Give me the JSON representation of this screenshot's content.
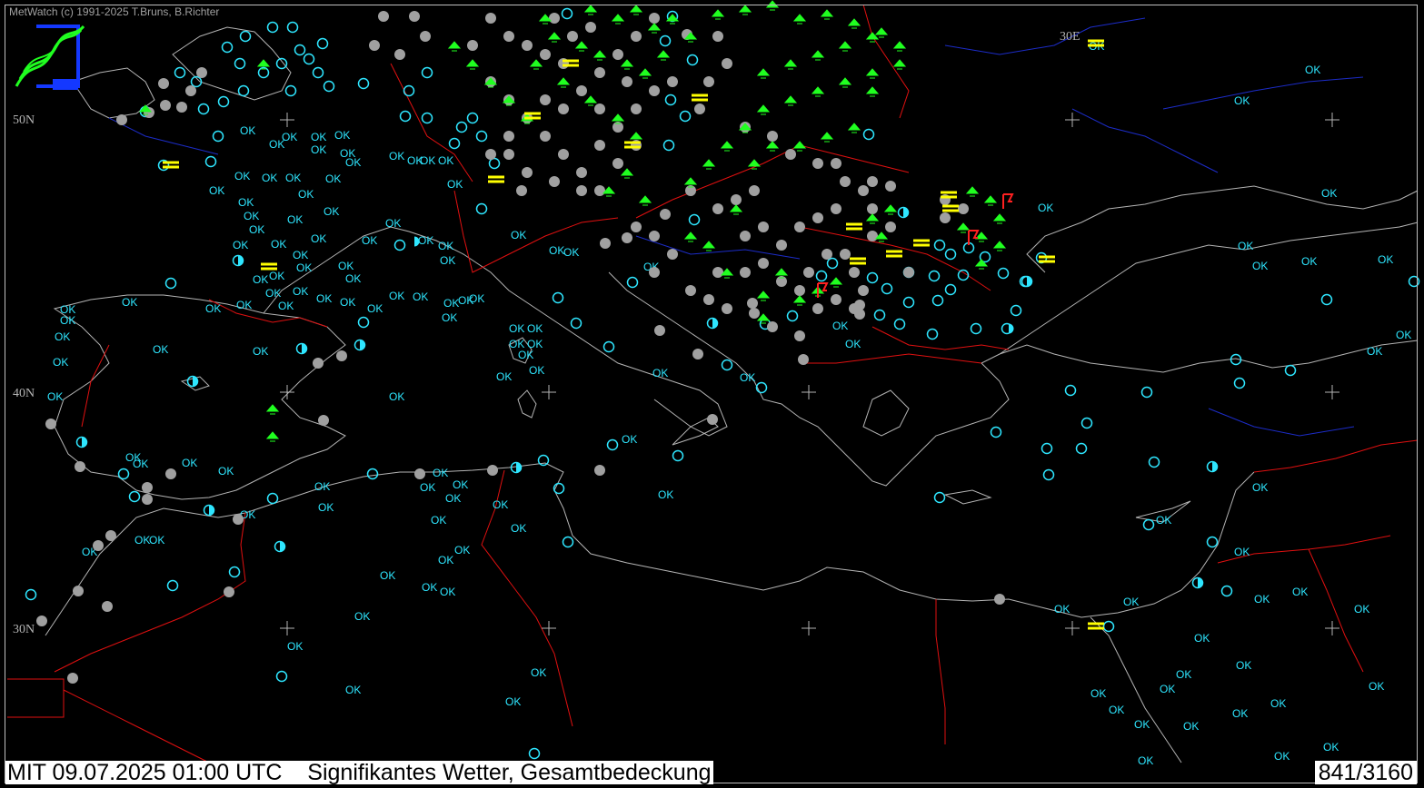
{
  "copyright": "MetWatch  (c) 1991-2025 T.Bruns, B.Richter",
  "status": {
    "datetime": "MIT 09.07.2025 01:00 UTC",
    "product": "Signifikantes Wetter, Gesamtbedeckung",
    "count": "841/3160"
  },
  "grid_labels": [
    "50N",
    "40N",
    "30N",
    "30E"
  ],
  "colors": {
    "background": "#000000",
    "coast": "#b4b4b4",
    "border": "#e01010",
    "river": "#1c2cc8",
    "clear_sky": "#2ee6ff",
    "overcast": "#a0a0a0",
    "rain": "#20ff20",
    "fog": "#ffff00",
    "thunder": "#ff2020"
  },
  "station_text": "OK",
  "legend_icons": [
    "clear-sky-ok",
    "partly-cloudy-circle",
    "overcast-grey-circle",
    "rain-green",
    "fog-yellow",
    "thunderstorm-red"
  ]
}
